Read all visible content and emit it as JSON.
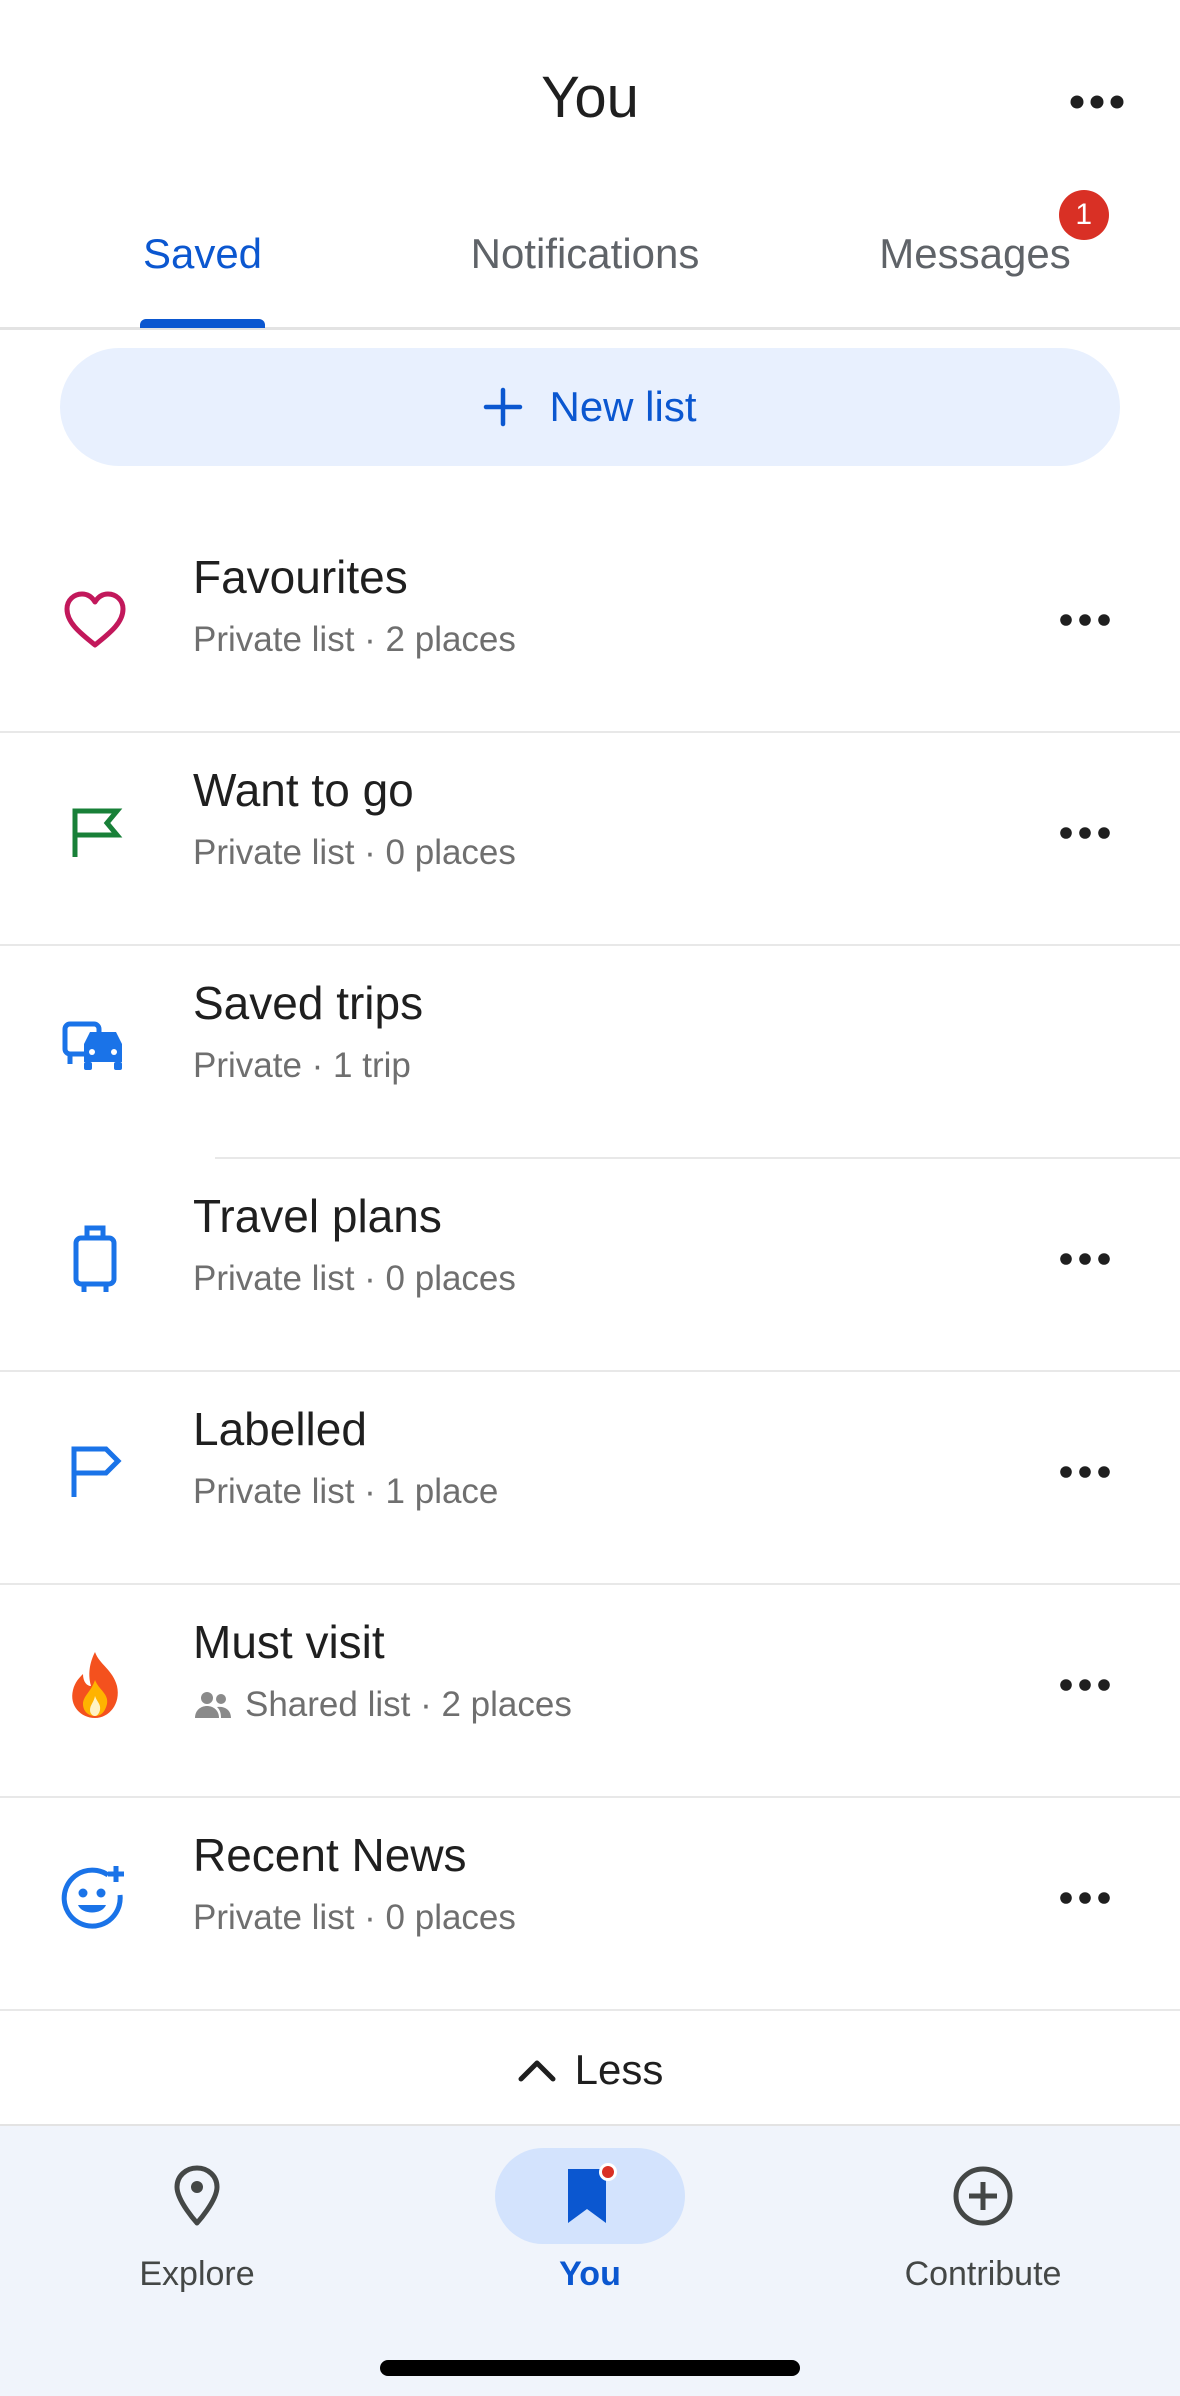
{
  "header": {
    "title": "You"
  },
  "tabs": [
    {
      "label": "Saved",
      "active": true
    },
    {
      "label": "Notifications",
      "active": false
    },
    {
      "label": "Messages",
      "active": false,
      "badge": "1"
    }
  ],
  "new_list": {
    "label": "New list"
  },
  "lists": [
    {
      "title": "Favourites",
      "subtitle": "Private list · 2 places",
      "icon": "heart-icon",
      "color": "#c2185b",
      "has_menu": true
    },
    {
      "title": "Want to go",
      "subtitle": "Private list · 0 places",
      "icon": "flag-icon",
      "color": "#188038",
      "has_menu": true
    },
    {
      "title": "Saved trips",
      "subtitle": "Private · 1 trip",
      "icon": "trip-icon",
      "color": "#1a73e8",
      "has_menu": false
    },
    {
      "title": "Travel plans",
      "subtitle": "Private list · 0 places",
      "icon": "luggage-icon",
      "color": "#1a73e8",
      "has_menu": true
    },
    {
      "title": "Labelled",
      "subtitle": "Private list · 1 place",
      "icon": "label-flag-icon",
      "color": "#1a73e8",
      "has_menu": true
    },
    {
      "title": "Must visit",
      "subtitle": "Shared list · 2 places",
      "icon": "fire-icon",
      "shared": true,
      "has_menu": true
    },
    {
      "title": "Recent News",
      "subtitle": "Private list · 0 places",
      "icon": "emoji-add-icon",
      "color": "#1a73e8",
      "has_menu": true
    }
  ],
  "less": {
    "label": "Less"
  },
  "nav": [
    {
      "label": "Explore",
      "icon": "location-pin-icon",
      "active": false
    },
    {
      "label": "You",
      "icon": "bookmark-icon",
      "active": true
    },
    {
      "label": "Contribute",
      "icon": "add-circle-icon",
      "active": false
    }
  ],
  "colors": {
    "accent": "#0b57d0",
    "badge": "#d93025",
    "pill": "#e8f0fe",
    "nav_bg": "#f0f4fb"
  }
}
